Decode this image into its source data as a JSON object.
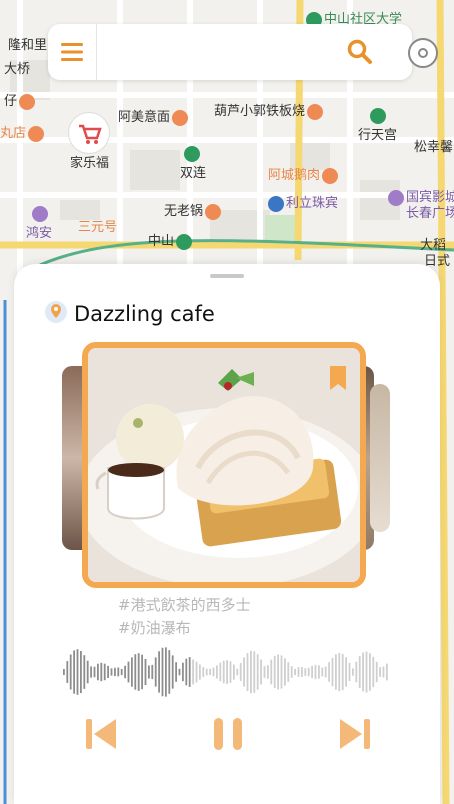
{
  "map": {
    "labels": [
      {
        "text": "中山社区大学",
        "cls": "green",
        "icon": "g"
      },
      {
        "text": "隆和里",
        "cls": "",
        "icon": ""
      },
      {
        "text": "大桥",
        "cls": "",
        "icon": ""
      },
      {
        "text": "阿美意面",
        "cls": "",
        "icon": "o"
      },
      {
        "text": "葫芦小郭铁板烧",
        "cls": "",
        "icon": "o"
      },
      {
        "text": "行天宫",
        "cls": "",
        "icon": "g"
      },
      {
        "text": "松幸馨",
        "cls": "",
        "icon": ""
      },
      {
        "text": "仔",
        "cls": "",
        "icon": "o"
      },
      {
        "text": "丸店",
        "cls": "orange",
        "icon": "o"
      },
      {
        "text": "家乐福",
        "cls": "",
        "icon": ""
      },
      {
        "text": "双连",
        "cls": "",
        "icon": "g"
      },
      {
        "text": "阿城鹅肉",
        "cls": "orange",
        "icon": "o"
      },
      {
        "text": "利立珠宾",
        "cls": "purple",
        "icon": "b"
      },
      {
        "text": "国宾影城",
        "cls": "purple",
        "icon": "p"
      },
      {
        "text": "长春广场",
        "cls": "purple",
        "icon": ""
      },
      {
        "text": "无老锅",
        "cls": "",
        "icon": "o"
      },
      {
        "text": "三元号",
        "cls": "orange",
        "icon": "o"
      },
      {
        "text": "鸿安",
        "cls": "purple",
        "icon": "p"
      },
      {
        "text": "中山",
        "cls": "",
        "icon": "g"
      },
      {
        "text": "大稻",
        "cls": "",
        "icon": ""
      },
      {
        "text": "日式",
        "cls": "",
        "icon": ""
      }
    ]
  },
  "search": {
    "placeholder": "",
    "value": ""
  },
  "panel": {
    "title": "Dazzling cafe",
    "tags": [
      "#港式飲茶的西多士",
      "#奶油瀑布"
    ]
  },
  "colors": {
    "accent": "#f4a84f",
    "menu": "#e8922e"
  }
}
